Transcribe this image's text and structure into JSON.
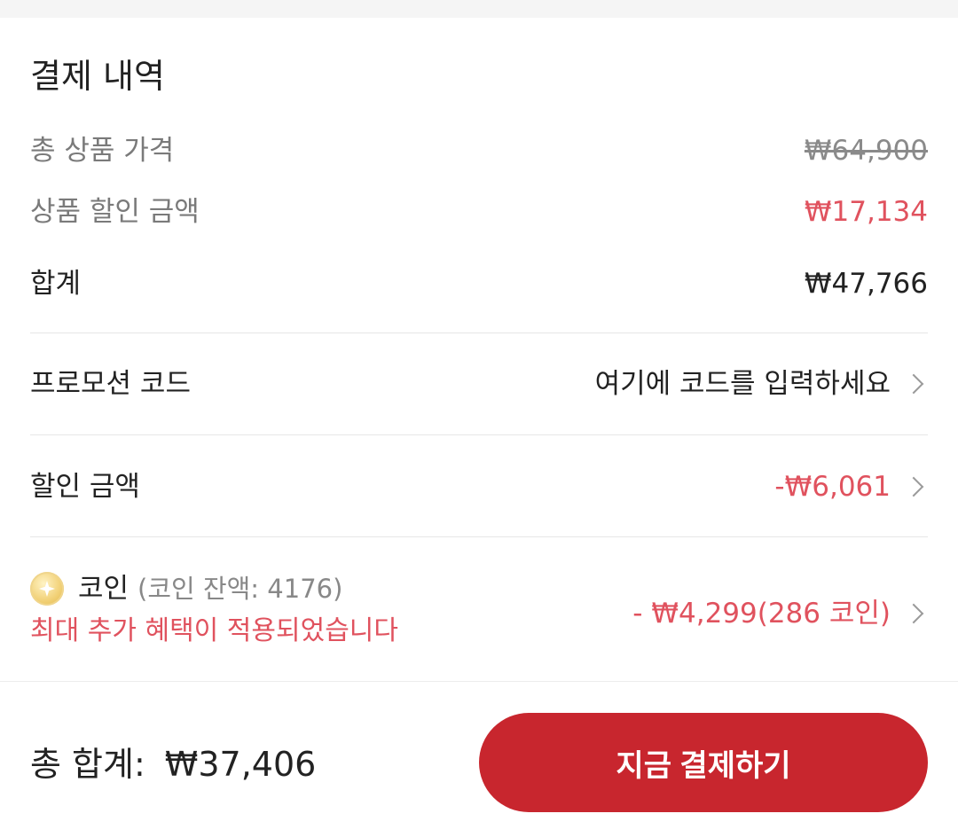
{
  "section": {
    "title": "결제 내역"
  },
  "rows": {
    "total_price": {
      "label": "총 상품 가격",
      "value": "₩64,900"
    },
    "product_discount": {
      "label": "상품 할인 금액",
      "value": "₩17,134"
    },
    "subtotal": {
      "label": "합계",
      "value": "₩47,766"
    },
    "promo": {
      "label": "프로모션 코드",
      "placeholder": "여기에 코드를 입력하세요"
    },
    "discount": {
      "label": "할인 금액",
      "value": "-₩6,061"
    }
  },
  "coins": {
    "label": "코인",
    "balance": "(코인 잔액: 4176)",
    "benefit": "최대 추가 혜택이 적용되었습니다",
    "value": "- ₩4,299(286 코인)"
  },
  "footer": {
    "total_label": "총 합계:",
    "total_value": "₩37,406",
    "pay_button": "지금 결제하기"
  },
  "colors": {
    "accent_red": "#c8262e",
    "discount_red": "#e0525e"
  },
  "icons": {
    "coin": "coin-icon",
    "chevron": "chevron-right-icon"
  }
}
